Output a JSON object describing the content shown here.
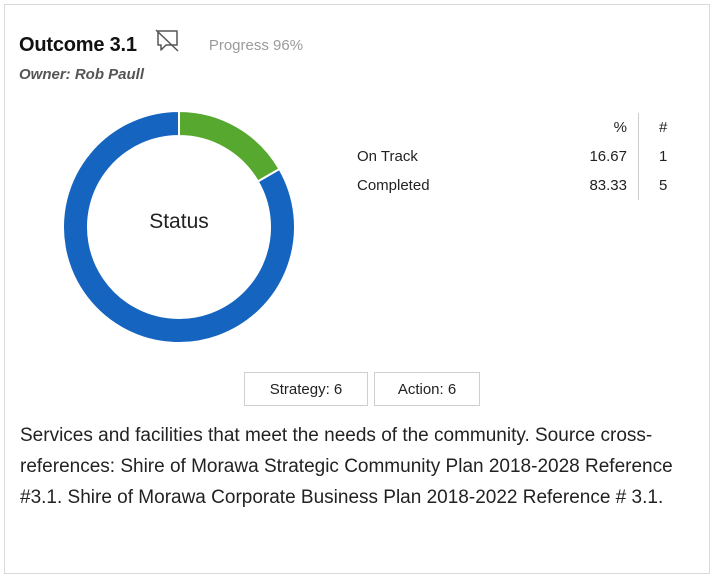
{
  "outcome": {
    "title": "Outcome 3.1",
    "progress_text": "Progress 96%",
    "owner": "Owner: Rob Paull",
    "comment_icon": "comment-off-icon"
  },
  "chart_data": {
    "type": "pie",
    "title": "Status",
    "labels": [
      "On Track",
      "Completed"
    ],
    "values": [
      16.67,
      83.33
    ],
    "colors": [
      "#57a82f",
      "#1565c0"
    ]
  },
  "status_table": {
    "headers": {
      "label": "",
      "percent": "%",
      "count": "#"
    },
    "rows": [
      {
        "label": "On Track",
        "percent": "16.67",
        "count": "1"
      },
      {
        "label": "Completed",
        "percent": "83.33",
        "count": "5"
      }
    ]
  },
  "buttons": {
    "strategy": "Strategy: 6",
    "action": "Action: 6"
  },
  "description": "Services and facilities that meet the needs of the community. Source cross-references: Shire of Morawa Strategic Community Plan 2018-2028 Reference #3.1. Shire of Morawa Corporate Business Plan 2018-2022 Reference # 3.1."
}
